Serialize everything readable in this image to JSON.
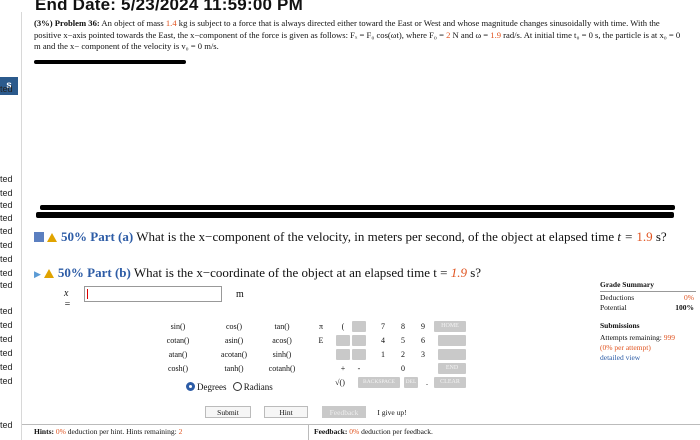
{
  "header": {
    "end_date": "End Date: 5/23/2024 11:59:00 PM"
  },
  "sidebar": {
    "tab_label": "s",
    "items": [
      "ted",
      "ted",
      "ted",
      "ted",
      "ted",
      "ted",
      "ted",
      "ted",
      "ted",
      "ted",
      "ted",
      "ted",
      "ted",
      "ted",
      "ted",
      "ted",
      "ted"
    ]
  },
  "problem": {
    "weight": "(3%)",
    "label": "Problem 36:",
    "text_1": "An object of mass",
    "mass": "1.4",
    "text_2": "kg is subject to a force that is always directed either toward the East or West and whose magnitude changes sinusoidally with time. With the positive x−axis pointed towards the East, the x−component of the force is given as follows: Fₓ = F₀ cos(ωt), where F₀ =",
    "force": "2",
    "text_3": "N and ω =",
    "omega": "1.9",
    "text_4": "rad/s. At initial time t₀ = 0 s, the particle is at x₀ = 0 m and the x− component of the velocity is v₀ = 0 m/s."
  },
  "part_a": {
    "percent": "50% Part (a)",
    "question": "What is the x−component of the velocity, in meters per second, of the object at elapsed time",
    "time_prefix": "t =",
    "time_value": "1.9",
    "time_suffix": "s?"
  },
  "part_b": {
    "percent": "50% Part (b)",
    "question": "What is the x−coordinate of the object at an elapsed time t =",
    "time_value": "1.9",
    "time_suffix": "s?",
    "input_label": "x =",
    "input_value": "",
    "unit": "m"
  },
  "keypad": {
    "functions": [
      [
        "sin()",
        "cos()",
        "tan()"
      ],
      [
        "cotan()",
        "asin()",
        "acos()"
      ],
      [
        "atan()",
        "acotan()",
        "sinh()"
      ],
      [
        "cosh()",
        "tanh()",
        "cotanh()"
      ]
    ],
    "symbols": [
      "π",
      "(",
      "E",
      "",
      "",
      "+",
      "-",
      "√()"
    ],
    "digits": [
      "7",
      "8",
      "9",
      "4",
      "5",
      "6",
      "1",
      "2",
      "3",
      "0",
      "."
    ],
    "home": "HOME",
    "end": "END",
    "backspace": "BACKSPACE",
    "del": "DEL",
    "clear": "CLEAR",
    "degrees": "Degrees",
    "radians": "Radians"
  },
  "actions": {
    "submit": "Submit",
    "hint": "Hint",
    "feedback": "Feedback",
    "give_up": "I give up!"
  },
  "grade_summary": {
    "title": "Grade Summary",
    "deductions_label": "Deductions",
    "deductions_value": "0%",
    "potential_label": "Potential",
    "potential_value": "100%",
    "submissions_title": "Submissions",
    "attempts_label": "Attempts remaining:",
    "attempts_value": "999",
    "per_attempt": "(0% per attempt)",
    "detail_link": "detailed view"
  },
  "footer": {
    "hints_label": "Hints:",
    "hints_pct": "0%",
    "hints_text": "deduction per hint. Hints remaining:",
    "hints_remaining": "2",
    "feedback_label": "Feedback:",
    "feedback_pct": "0%",
    "feedback_text": "deduction per feedback."
  }
}
